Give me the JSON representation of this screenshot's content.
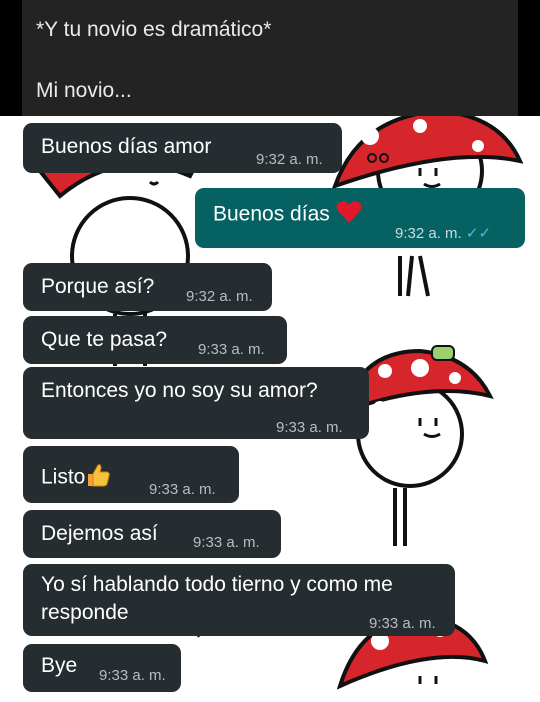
{
  "header": {
    "line1": "*Y tu novio es dramático*",
    "line2": "Mi novio..."
  },
  "messages": [
    {
      "text": "Buenos días amor",
      "time": "9:32 a. m.",
      "direction": "in"
    },
    {
      "text": "Buenos días",
      "emoji": "heart-emoji",
      "time": "9:32 a. m.",
      "direction": "out",
      "status": "read"
    },
    {
      "text": "Porque así?",
      "time": "9:32 a. m.",
      "direction": "in"
    },
    {
      "text": "Que te pasa?",
      "time": "9:33 a. m.",
      "direction": "in"
    },
    {
      "text": "Entonces yo no soy su amor?",
      "time": "9:33 a. m.",
      "direction": "in"
    },
    {
      "text": "Listo",
      "emoji": "thumbs-up-emoji",
      "time": "9:33 a. m.",
      "direction": "in"
    },
    {
      "text": "Dejemos así",
      "time": "9:33 a. m.",
      "direction": "in"
    },
    {
      "text": "Yo sí hablando todo tierno y como me responde",
      "time": "9:33 a. m.",
      "direction": "in"
    },
    {
      "text": "Bye",
      "time": "9:33 a. m.",
      "direction": "in"
    }
  ],
  "colors": {
    "incoming_bubble": "#262d31",
    "outgoing_bubble": "#056162",
    "read_ticks": "#4fb8e8",
    "mushroom_cap": "#d7262b"
  }
}
